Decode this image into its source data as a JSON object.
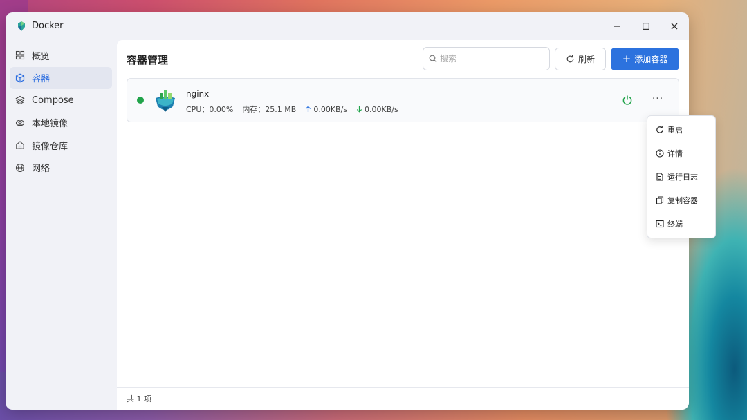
{
  "window": {
    "title": "Docker",
    "controls": {
      "minimize": "—",
      "maximize": "☐",
      "close": "✕"
    }
  },
  "sidebar": {
    "items": [
      {
        "label": "概览",
        "icon": "grid-icon"
      },
      {
        "label": "容器",
        "icon": "cube-icon",
        "active": true
      },
      {
        "label": "Compose",
        "icon": "layers-icon"
      },
      {
        "label": "本地镜像",
        "icon": "disk-icon"
      },
      {
        "label": "镜像仓库",
        "icon": "home-icon"
      },
      {
        "label": "网络",
        "icon": "globe-icon"
      }
    ]
  },
  "main": {
    "title": "容器管理",
    "search": {
      "placeholder": "搜索",
      "value": ""
    },
    "refresh_label": "刷新",
    "add_label": "添加容器",
    "add_plus": "+",
    "containers": [
      {
        "name": "nginx",
        "status": "running",
        "cpu": "CPU：0.00%",
        "memory": "内存：25.1 MB",
        "upload": "0.00KB/s",
        "download": "0.00KB/s",
        "more": "···"
      }
    ],
    "footer_count": "共 1 项"
  },
  "context_menu": {
    "items": [
      {
        "label": "重启",
        "icon": "restart-icon"
      },
      {
        "label": "详情",
        "icon": "info-icon"
      },
      {
        "label": "运行日志",
        "icon": "log-icon"
      },
      {
        "label": "复制容器",
        "icon": "copy-icon"
      },
      {
        "label": "终端",
        "icon": "terminal-icon"
      }
    ]
  },
  "colors": {
    "accent": "#2c72de",
    "running": "#21a34a",
    "arrow_up": "#2c72de",
    "arrow_down": "#21a34a"
  }
}
